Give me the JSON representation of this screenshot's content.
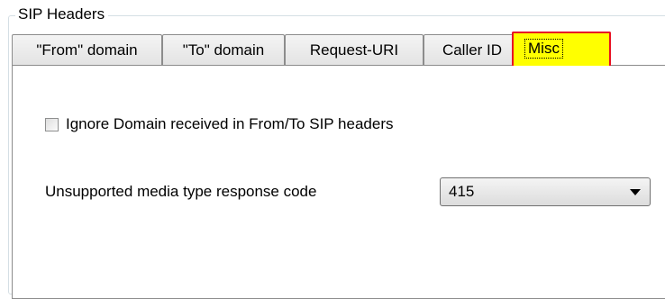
{
  "group": {
    "title": "SIP Headers"
  },
  "tabs": [
    {
      "label": "\"From\" domain",
      "selected": false
    },
    {
      "label": "\"To\" domain",
      "selected": false
    },
    {
      "label": "Request-URI",
      "selected": false
    },
    {
      "label": "Caller ID",
      "selected": false
    },
    {
      "label": "Misc",
      "selected": true
    }
  ],
  "misc_page": {
    "ignore_domain_checkbox": {
      "label": "Ignore Domain received in From/To SIP headers",
      "checked": false
    },
    "unsupported_media": {
      "label": "Unsupported media type response code",
      "selected_value": "415"
    }
  },
  "colors": {
    "highlight_fill": "#ffff00",
    "highlight_border": "#e81123"
  }
}
